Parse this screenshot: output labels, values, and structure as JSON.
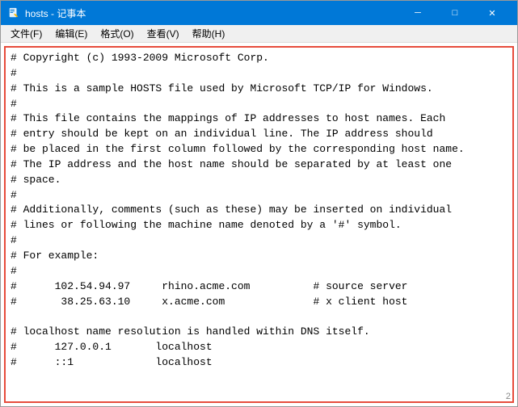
{
  "titleBar": {
    "title": "hosts - 记事本",
    "minimizeLabel": "─",
    "maximizeLabel": "□",
    "closeLabel": "✕"
  },
  "menuBar": {
    "items": [
      "文件(F)",
      "编辑(E)",
      "格式(O)",
      "查看(V)",
      "帮助(H)"
    ]
  },
  "content": {
    "text": "# Copyright (c) 1993-2009 Microsoft Corp.\n#\n# This is a sample HOSTS file used by Microsoft TCP/IP for Windows.\n#\n# This file contains the mappings of IP addresses to host names. Each\n# entry should be kept on an individual line. The IP address should\n# be placed in the first column followed by the corresponding host name.\n# The IP address and the host name should be separated by at least one\n# space.\n#\n# Additionally, comments (such as these) may be inserted on individual\n# lines or following the machine name denoted by a '#' symbol.\n#\n# For example:\n#\n#      102.54.94.97     rhino.acme.com          # source server\n#       38.25.63.10     x.acme.com              # x client host\n\n# localhost name resolution is handled within DNS itself.\n#      127.0.0.1       localhost\n#      ::1             localhost"
  },
  "watermark": "2"
}
